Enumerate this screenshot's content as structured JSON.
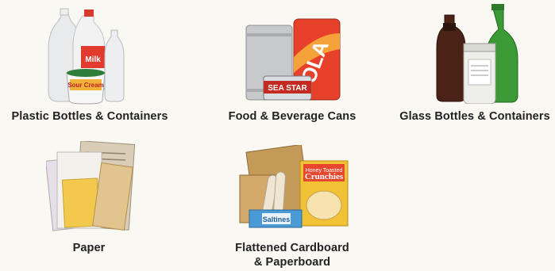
{
  "categories": [
    {
      "id": "plastic",
      "label": "Plastic Bottles & Containers",
      "icon": "plastic-bottles-image",
      "milk_text": "Milk",
      "sour_cream_text": "Sour Cream"
    },
    {
      "id": "cans",
      "label": "Food & Beverage Cans",
      "icon": "cans-image",
      "cola_text": "OLA",
      "tuna_text": "SEA STAR"
    },
    {
      "id": "glass",
      "label": "Glass Bottles & Containers",
      "icon": "glass-bottles-image"
    },
    {
      "id": "paper",
      "label": "Paper",
      "icon": "paper-stack-image"
    },
    {
      "id": "cardboard",
      "label_line1": "Flattened Cardboard",
      "label_line2": "& Paperboard",
      "icon": "cardboard-image",
      "cereal_text": "Crunchies",
      "cereal_small": "Honey Toasted",
      "crackers_text": "Saltines"
    }
  ]
}
